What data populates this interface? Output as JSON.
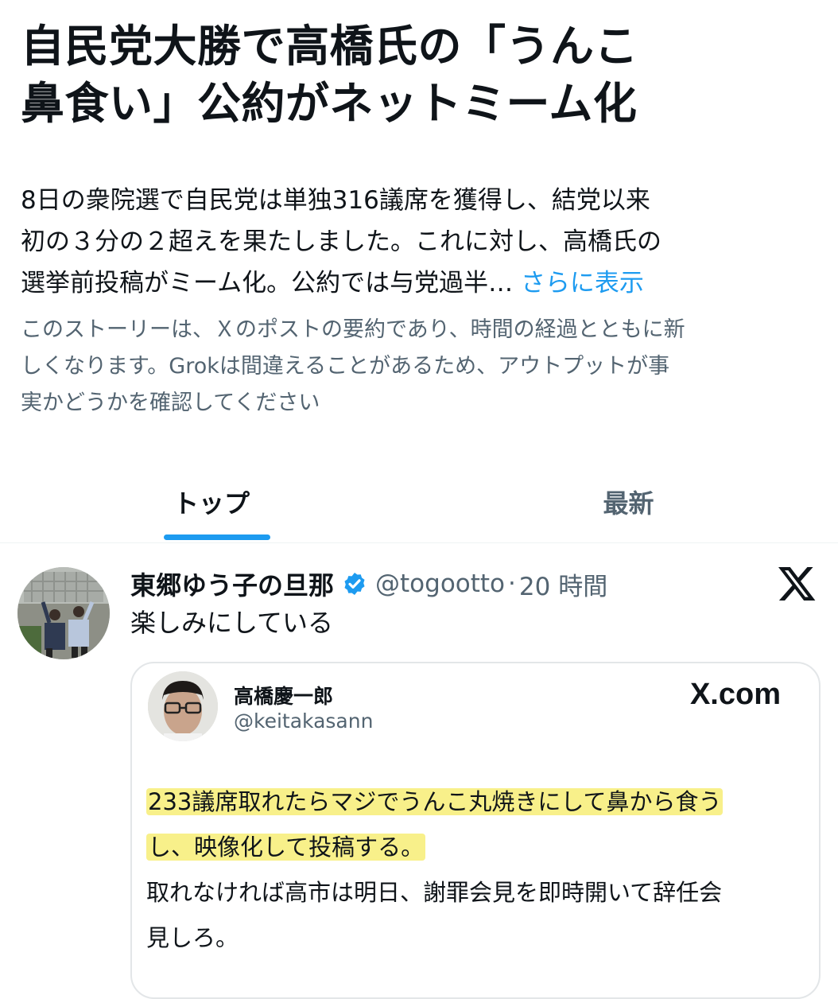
{
  "story": {
    "headline_lines": [
      "自民党大勝で高橋氏の「うんこ",
      "鼻食い」公約がネットミーム化"
    ],
    "summary_lines": [
      "8日の衆院選で自民党は単独316議席を獲得し、結党以来",
      "初の３分の２超えを果たしました。これに対し、高橋氏の",
      "選挙前投稿がミーム化。公約では与党過半…"
    ],
    "show_more": "さらに表示",
    "disclaimer_lines": [
      "このストーリーは、Ｘのポストの要約であり、時間の経過とともに新",
      "しくなります。Grokは間違えることがあるため、アウトプットが事",
      "実かどうかを確認してください"
    ]
  },
  "tabs": {
    "top": "トップ",
    "latest": "最新",
    "active": "top"
  },
  "post": {
    "display_name": "東郷ゆう子の旦那",
    "handle": "@togootto",
    "separator": "·",
    "time": "20 時間",
    "text": "楽しみにしている",
    "quote": {
      "name": "高橋慶一郎",
      "handle": "@keitakasann",
      "source": "X.com",
      "highlight_lines": [
        "233議席取れたらマジでうんこ丸焼きにして鼻から食う",
        "し、映像化して投稿する。"
      ],
      "body_lines": [
        "取れなければ高市は明日、謝罪会見を即時開いて辞任会",
        "見しろ。"
      ]
    }
  },
  "colors": {
    "accent": "#1d9bf0",
    "text": "#0f1419",
    "secondary": "#536471",
    "highlight": "#f8f08a"
  },
  "icons": [
    "verified-badge-icon",
    "x-logo-icon"
  ]
}
